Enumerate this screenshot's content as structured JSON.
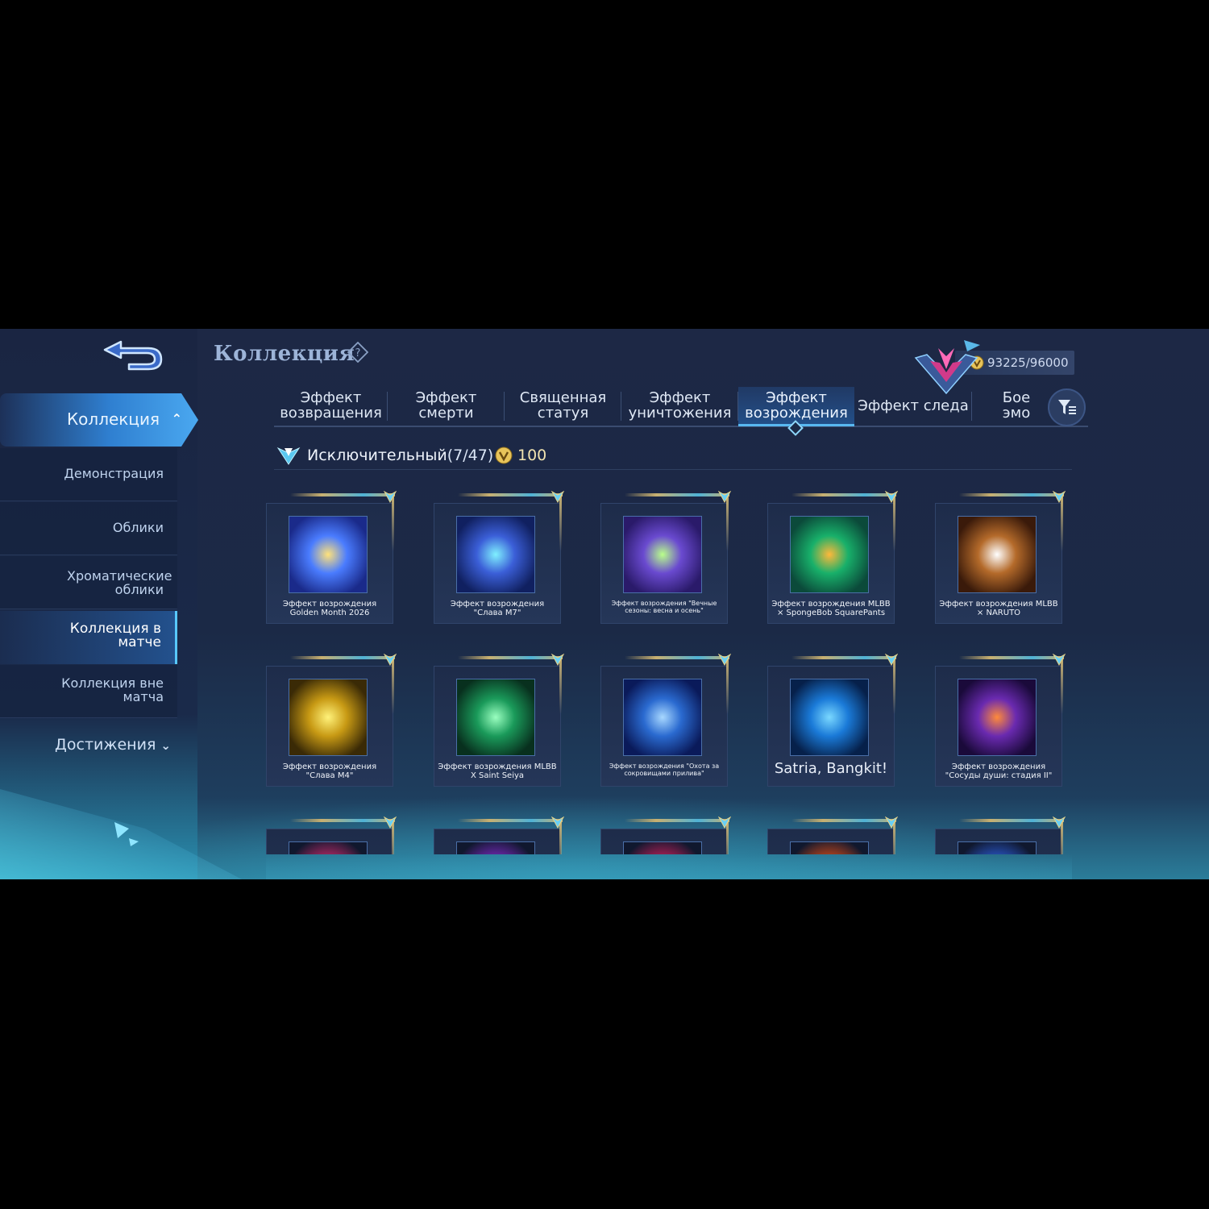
{
  "header": {
    "title": "Коллекция",
    "points": "93225/96000"
  },
  "sidebar": {
    "main": "Коллекция",
    "items": [
      {
        "label": "Демонстрация"
      },
      {
        "label": "Облики"
      },
      {
        "label": "Хроматические облики"
      },
      {
        "label": "Коллекция в матче"
      },
      {
        "label": "Коллекция вне матча"
      }
    ],
    "achievements": "Достижения"
  },
  "tabs": [
    {
      "line1": "Эффект",
      "line2": "возвращения"
    },
    {
      "line1": "Эффект",
      "line2": "смерти"
    },
    {
      "line1": "Священная",
      "line2": "статуя"
    },
    {
      "line1": "Эффект",
      "line2": "уничтожения"
    },
    {
      "line1": "Эффект",
      "line2": "возрождения"
    },
    {
      "line1": "Эффект следа",
      "line2": ""
    },
    {
      "line1": "Бое",
      "line2": "эмо"
    }
  ],
  "rarity": {
    "name": "Исключительный",
    "count": "(7/47)",
    "price": "100"
  },
  "items": [
    {
      "line1": "Эффект возрождения",
      "line2": "Golden Month 2026",
      "colors": [
        "#1a2a8a",
        "#4a7cff",
        "#ffe27a"
      ]
    },
    {
      "line1": "Эффект возрождения",
      "line2": "\"Слава M7\"",
      "colors": [
        "#102060",
        "#3b5fd8",
        "#7ff0ff"
      ]
    },
    {
      "line1": "Эффект возрождения \"Вечные",
      "line2": "сезоны: весна и осень\"",
      "colors": [
        "#2a1a6a",
        "#6a4ad0",
        "#b9ff8a"
      ]
    },
    {
      "line1": "Эффект возрождения MLBB",
      "line2": "× SpongeBob SquarePants",
      "colors": [
        "#0b4a3a",
        "#18b06a",
        "#ffb83a"
      ]
    },
    {
      "line1": "Эффект возрождения MLBB",
      "line2": "× NARUTO",
      "colors": [
        "#3a1a0a",
        "#b46a2a",
        "#ffffff"
      ]
    },
    {
      "line1": "Эффект возрождения",
      "line2": "\"Слава M4\"",
      "colors": [
        "#3a2a06",
        "#c89a14",
        "#fff27a"
      ]
    },
    {
      "line1": "Эффект возрождения MLBB",
      "line2": "X Saint Seiya",
      "colors": [
        "#08301e",
        "#1a9a5a",
        "#9affc0"
      ]
    },
    {
      "line1": "Эффект возрождения \"Охота за",
      "line2": "сокровищами прилива\"",
      "colors": [
        "#0a1a5a",
        "#2a6ad0",
        "#a8d8ff"
      ]
    },
    {
      "line1": "Satria, Bangkit!",
      "line2": "",
      "colors": [
        "#06204a",
        "#1a7ad8",
        "#7ad8ff"
      ]
    },
    {
      "line1": "Эффект возрождения",
      "line2": "\"Сосуды души: стадия II\"",
      "colors": [
        "#1a0a3a",
        "#6a2ab0",
        "#ff8a3a"
      ]
    }
  ],
  "partial_row_colors": [
    "#c02a6a",
    "#7a2ac0",
    "#c0205a",
    "#d04a1a",
    "#2a5ad0"
  ]
}
